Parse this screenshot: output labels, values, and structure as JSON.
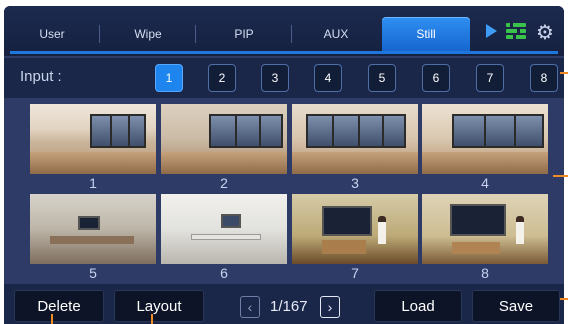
{
  "tabs": [
    {
      "label": "User",
      "active": false
    },
    {
      "label": "Wipe",
      "active": false
    },
    {
      "label": "PIP",
      "active": false
    },
    {
      "label": "AUX",
      "active": false
    },
    {
      "label": "Still",
      "active": true
    }
  ],
  "header_icons": [
    "play-icon",
    "controller-icon",
    "gear-icon"
  ],
  "input": {
    "label": "Input :",
    "buttons": [
      "1",
      "2",
      "3",
      "4",
      "5",
      "6",
      "7",
      "8"
    ],
    "selected": "1"
  },
  "stills": [
    {
      "caption": "1"
    },
    {
      "caption": "2"
    },
    {
      "caption": "3"
    },
    {
      "caption": "4"
    },
    {
      "caption": "5"
    },
    {
      "caption": "6"
    },
    {
      "caption": "7"
    },
    {
      "caption": "8"
    }
  ],
  "bottom": {
    "delete_label": "Delete",
    "layout_label": "Layout",
    "page_text": "1/167",
    "load_label": "Load",
    "save_label": "Save"
  },
  "colors": {
    "accent": "#1e84ee",
    "panel": "#2e3b66",
    "callout": "#f08a24"
  }
}
